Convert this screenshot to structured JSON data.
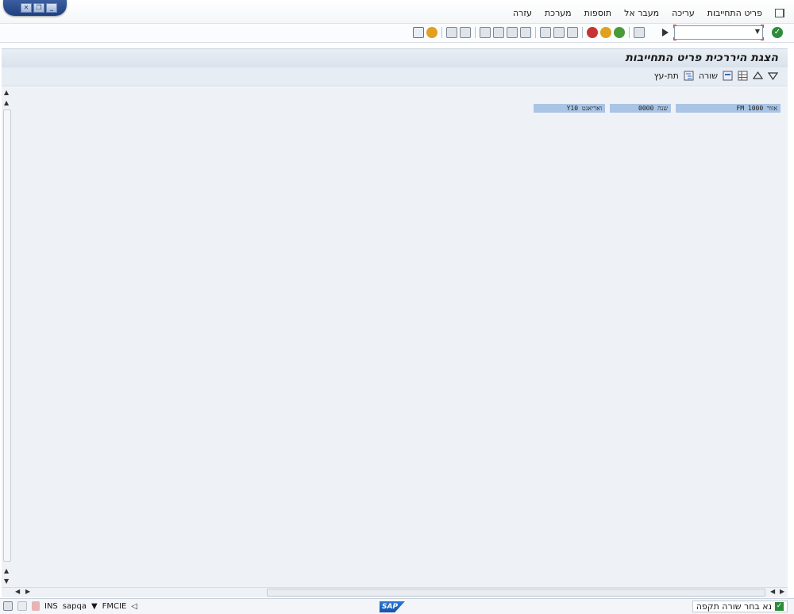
{
  "menu": {
    "items": [
      "פריט התחייבות",
      "עריכה",
      "מעבר אל",
      "תוספות",
      "מערכת",
      "עזרה"
    ]
  },
  "toolbar": {
    "command_value": ""
  },
  "title": "הצגת היררכית פריט התחייבות",
  "app_toolbar": {
    "row_label": "שורה",
    "subtree_label": "תת-עץ"
  },
  "fields": [
    {
      "label": "אזור FM 1000"
    },
    {
      "label": "שנה 0000"
    },
    {
      "label": "ואריאנט Y10"
    }
  ],
  "status": {
    "message": "נא בחר שורה תקפה",
    "system": "FMCIE",
    "client": "sapqa",
    "mode": "INS",
    "logo": "SAP"
  }
}
